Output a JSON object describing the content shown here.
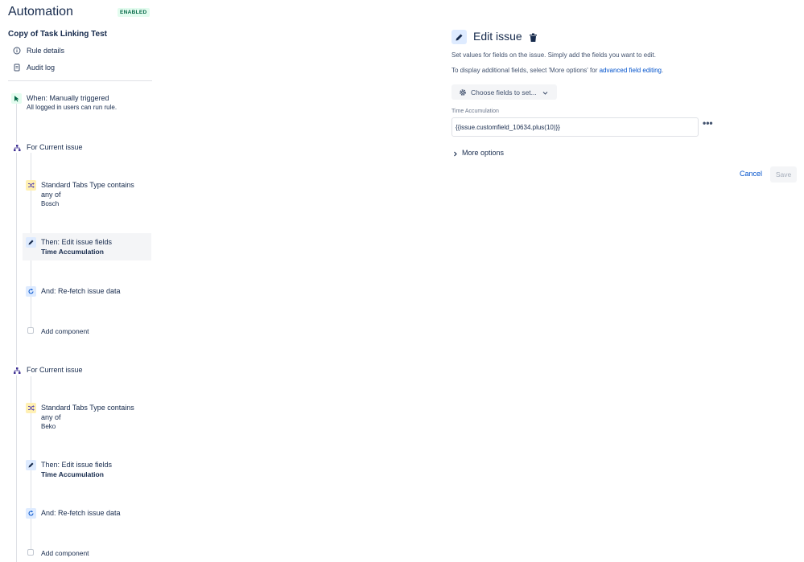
{
  "app": {
    "title": "Automation",
    "status_badge": "ENABLED"
  },
  "rule": {
    "name": "Copy of Task Linking Test"
  },
  "nav": [
    {
      "label": "Rule details",
      "icon": "info-icon"
    },
    {
      "label": "Audit log",
      "icon": "audit-log-icon"
    }
  ],
  "trigger": {
    "label": "When: Manually triggered",
    "sub": "All logged in users can run rule.",
    "icon": "cursor-click-icon"
  },
  "branches": [
    {
      "label": "For Current issue",
      "icon": "branch-icon",
      "condition": {
        "line1": "Standard Tabs Type contains",
        "line2": "any of",
        "value": "Bosch",
        "icon": "shuffle-icon"
      },
      "action": {
        "label": "Then: Edit issue fields",
        "detail": "Time Accumulation",
        "icon": "pencil-icon"
      },
      "refetch": {
        "label": "And: Re-fetch issue data",
        "icon": "refresh-icon"
      },
      "add": {
        "label": "Add component"
      }
    },
    {
      "label": "For Current issue",
      "icon": "branch-icon",
      "condition": {
        "line1": "Standard Tabs Type contains",
        "line2": "any of",
        "value": "Beko",
        "icon": "shuffle-icon"
      },
      "action": {
        "label": "Then: Edit issue fields",
        "detail": "Time Accumulation",
        "icon": "pencil-icon"
      },
      "refetch": {
        "label": "And: Re-fetch issue data",
        "icon": "refresh-icon"
      },
      "add": {
        "label": "Add component"
      }
    }
  ],
  "panel": {
    "title": "Edit issue",
    "desc1": "Set values for fields on the issue. Simply add the fields you want to edit.",
    "desc2_prefix": "To display additional fields, select 'More options' for ",
    "desc2_link": "advanced field editing",
    "desc2_suffix": ".",
    "choose_button": "Choose fields to set...",
    "field_label": "Time Accumulation",
    "field_value": "{{issue.customfield_10634.plus(10)}}",
    "more_options": "More options",
    "cancel": "Cancel",
    "save": "Save"
  },
  "colors": {
    "accent": "#0052cc",
    "text": "#172b4d",
    "badge_bg": "#e3fcef",
    "badge_text": "#006644",
    "condition_bg": "#fff0b3",
    "action_bg": "#deebff"
  }
}
